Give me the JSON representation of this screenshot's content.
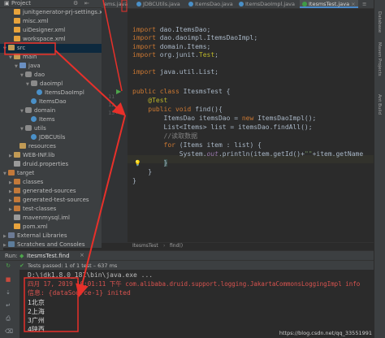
{
  "project_panel": {
    "title": "Project",
    "rows": [
      {
        "label": "junitgenerator-prj-settings.x",
        "icon": "xml-file-icon",
        "indent": 1,
        "arrow": ""
      },
      {
        "label": "misc.xml",
        "icon": "xml-file-icon",
        "indent": 1,
        "arrow": ""
      },
      {
        "label": "uiDesigner.xml",
        "icon": "xml-file-icon",
        "indent": 1,
        "arrow": ""
      },
      {
        "label": "workspace.xml",
        "icon": "xml-file-icon",
        "indent": 1,
        "arrow": ""
      },
      {
        "label": "src",
        "icon": "folder-icon",
        "indent": 0,
        "arrow": "▼",
        "selected": true
      },
      {
        "label": "main",
        "icon": "folder-icon",
        "indent": 1,
        "arrow": "▼"
      },
      {
        "label": "java",
        "icon": "source-folder-icon",
        "indent": 2,
        "arrow": "▼"
      },
      {
        "label": "dao",
        "icon": "package-icon",
        "indent": 3,
        "arrow": "▼"
      },
      {
        "label": "daoimpl",
        "icon": "package-icon",
        "indent": 4,
        "arrow": "▼"
      },
      {
        "label": "ItemsDaoImpl",
        "icon": "class-icon",
        "indent": 5,
        "arrow": ""
      },
      {
        "label": "ItemsDao",
        "icon": "class-icon",
        "indent": 4,
        "arrow": ""
      },
      {
        "label": "domain",
        "icon": "package-icon",
        "indent": 3,
        "arrow": "▼"
      },
      {
        "label": "Items",
        "icon": "class-icon",
        "indent": 4,
        "arrow": ""
      },
      {
        "label": "utils",
        "icon": "package-icon",
        "indent": 3,
        "arrow": "▼"
      },
      {
        "label": "JDBCUtils",
        "icon": "class-icon",
        "indent": 4,
        "arrow": ""
      },
      {
        "label": "resources",
        "icon": "folder-icon",
        "indent": 2,
        "arrow": ""
      },
      {
        "label": "WEB-INF.lib",
        "icon": "folder-icon",
        "indent": 1,
        "arrow": "▶"
      },
      {
        "label": "druid.properties",
        "icon": "properties-file-icon",
        "indent": 1,
        "arrow": ""
      },
      {
        "label": "target",
        "icon": "folder-orange-icon",
        "indent": 0,
        "arrow": "▼"
      },
      {
        "label": "classes",
        "icon": "folder-orange-icon",
        "indent": 1,
        "arrow": "▶"
      },
      {
        "label": "generated-sources",
        "icon": "folder-orange-icon",
        "indent": 1,
        "arrow": "▶"
      },
      {
        "label": "generated-test-sources",
        "icon": "folder-orange-icon",
        "indent": 1,
        "arrow": "▶"
      },
      {
        "label": "test-classes",
        "icon": "folder-orange-icon",
        "indent": 1,
        "arrow": "▶"
      },
      {
        "label": "mavenmysql.iml",
        "icon": "iml-file-icon",
        "indent": 1,
        "arrow": ""
      },
      {
        "label": "pom.xml",
        "icon": "xml-file-icon",
        "indent": 1,
        "arrow": ""
      },
      {
        "label": "External Libraries",
        "icon": "library-icon",
        "indent": 0,
        "arrow": "▶"
      },
      {
        "label": "Scratches and Consoles",
        "icon": "scratch-icon",
        "indent": 0,
        "arrow": "▶"
      }
    ]
  },
  "editor": {
    "tabs": [
      {
        "label": "ems.java",
        "active": false,
        "icon": "class-icon"
      },
      {
        "label": "JDBCUtils.java",
        "active": false,
        "icon": "class-icon"
      },
      {
        "label": "ItemsDao.java",
        "active": false,
        "icon": "class-icon"
      },
      {
        "label": "ItemsDaoImpl.java",
        "active": false,
        "icon": "class-icon"
      },
      {
        "label": "ItesmsTest.java",
        "active": true,
        "icon": "test-class-icon"
      }
    ],
    "line_numbers": [
      "11",
      "12",
      "13"
    ],
    "breadcrumb": [
      "ItesmsTest",
      "find()"
    ]
  },
  "right_strip": {
    "labels": [
      "Database",
      "Maven Projects",
      "Ant Build"
    ]
  },
  "run_panel": {
    "label": "Run:",
    "tab": "ItesmsTest.find",
    "status": "Tests passed: 1 of 1 test – 637 ms",
    "console": {
      "command": "D:\\jdk1.8.0_181\\bin\\java.exe ...",
      "log": "四月 17, 2019 10:01:11 下午 com.alibaba.druid.support.logging.JakartaCommonsLoggingImpl info",
      "info": "信息: {dataSource-1} inited",
      "results": [
        "1北京",
        "2上海",
        "3广州",
        "4陕西"
      ]
    }
  },
  "watermark": "https://blog.csdn.net/qq_33551991",
  "colors": {
    "annotation": "#e8302a",
    "selection": "#0d293e"
  }
}
